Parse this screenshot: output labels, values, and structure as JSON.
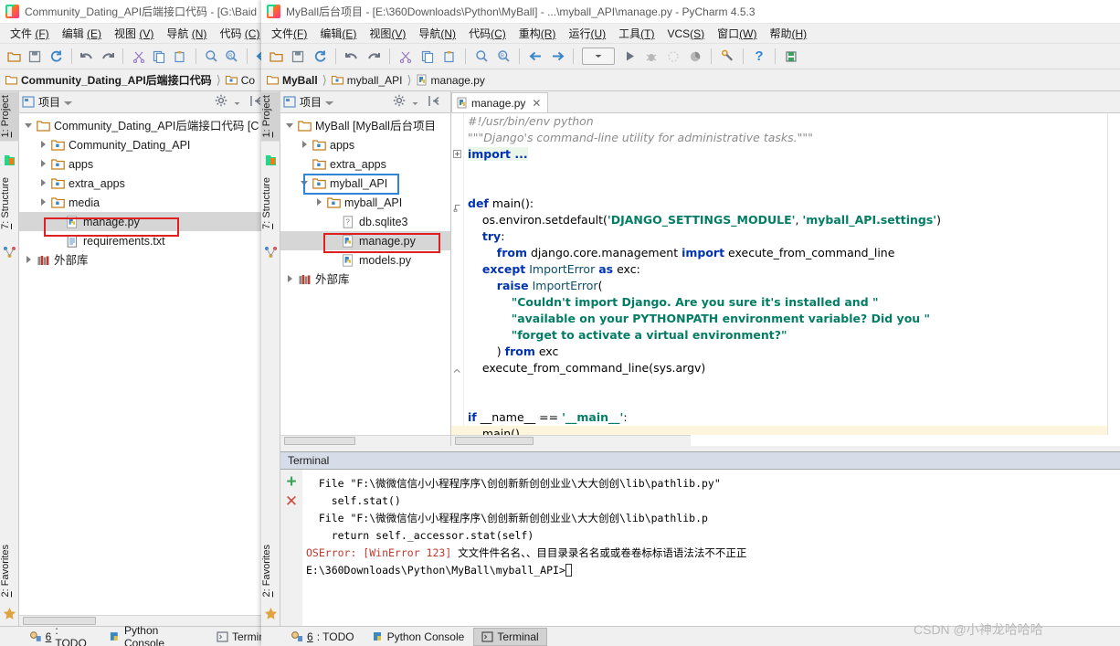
{
  "left_window": {
    "title": "Community_Dating_API后端接口代码 - [G:\\Baid",
    "menus": [
      {
        "label": "文件",
        "mnemonic": "(F)"
      },
      {
        "label": "编辑",
        "mnemonic": "(E)"
      },
      {
        "label": "视图",
        "mnemonic": "(V)"
      },
      {
        "label": "导航",
        "mnemonic": "(N)"
      },
      {
        "label": "代码",
        "mnemonic": "(C)"
      }
    ],
    "breadcrumbs": [
      {
        "label": "Community_Dating_API后端接口代码",
        "icon": "folder-icon",
        "bold": true
      },
      {
        "label": "Co",
        "icon": "module-folder-icon",
        "bold": false
      }
    ],
    "rail_tabs": [
      {
        "num": "1",
        "label": ": Project",
        "icon": "project-icon",
        "active": true
      },
      {
        "num": "7",
        "label": ": Structure",
        "icon": "structure-icon",
        "active": false
      },
      {
        "num": "2",
        "label": ": Favorites",
        "icon": "star-icon",
        "active": false
      }
    ],
    "tool_window": {
      "title": "项目",
      "gear_icon": "gear-icon",
      "collapse_icon": "collapse-all-icon"
    },
    "tree": [
      {
        "label": "Community_Dating_API后端接口代码 [C",
        "icon": "folder-icon",
        "twisty": "expanded",
        "indent": 0,
        "bold_part": "[C",
        "selected": false
      },
      {
        "label": "Community_Dating_API",
        "icon": "module-folder-icon",
        "twisty": "collapsed",
        "indent": 1,
        "selected": false
      },
      {
        "label": "apps",
        "icon": "module-folder-icon",
        "twisty": "collapsed",
        "indent": 1,
        "selected": false
      },
      {
        "label": "extra_apps",
        "icon": "module-folder-icon",
        "twisty": "collapsed",
        "indent": 1,
        "selected": false
      },
      {
        "label": "media",
        "icon": "module-folder-icon",
        "twisty": "collapsed",
        "indent": 1,
        "selected": false
      },
      {
        "label": "manage.py",
        "icon": "python-file-icon",
        "twisty": "none",
        "indent": 2,
        "selected": true,
        "highlight": "red"
      },
      {
        "label": "requirements.txt",
        "icon": "text-file-icon",
        "twisty": "none",
        "indent": 2,
        "selected": false
      },
      {
        "label": "外部库",
        "icon": "external-library-icon",
        "twisty": "collapsed",
        "indent": 0,
        "selected": false
      }
    ],
    "statusbar": [
      {
        "num": "6",
        "label": ": TODO",
        "icon": "todo-icon",
        "active": false
      },
      {
        "num": "",
        "label": "Python Console",
        "icon": "python-console-icon",
        "active": false
      },
      {
        "num": "",
        "label": "Termin",
        "icon": "terminal-icon",
        "active": false
      }
    ]
  },
  "right_window": {
    "title": "MyBall后台项目 - [E:\\360Downloads\\Python\\MyBall] - ...\\myball_API\\manage.py - PyCharm 4.5.3",
    "menus": [
      {
        "label": "文件",
        "mnemonic": "(F)"
      },
      {
        "label": "编辑",
        "mnemonic": "(E)"
      },
      {
        "label": "视图",
        "mnemonic": "(V)"
      },
      {
        "label": "导航",
        "mnemonic": "(N)"
      },
      {
        "label": "代码",
        "mnemonic": "(C)"
      },
      {
        "label": "重构",
        "mnemonic": "(R)"
      },
      {
        "label": "运行",
        "mnemonic": "(U)"
      },
      {
        "label": "工具",
        "mnemonic": "(T)"
      },
      {
        "label": "VCS",
        "mnemonic": "(S)"
      },
      {
        "label": "窗口",
        "mnemonic": "(W)"
      },
      {
        "label": "帮助",
        "mnemonic": "(H)"
      }
    ],
    "breadcrumbs": [
      {
        "label": "MyBall",
        "icon": "folder-icon",
        "bold": true
      },
      {
        "label": "myball_API",
        "icon": "module-folder-icon",
        "bold": false
      },
      {
        "label": "manage.py",
        "icon": "python-file-icon",
        "bold": false
      }
    ],
    "rail_tabs": [
      {
        "num": "1",
        "label": ": Project",
        "icon": "project-icon",
        "active": true
      },
      {
        "num": "7",
        "label": ": Structure",
        "icon": "structure-icon",
        "active": false
      },
      {
        "num": "2",
        "label": ": Favorites",
        "icon": "star-icon",
        "active": false
      }
    ],
    "tool_window": {
      "title": "项目",
      "gear_icon": "gear-icon",
      "collapse_icon": "collapse-all-icon"
    },
    "tree": [
      {
        "label": "MyBall [MyBall后台项目",
        "icon": "folder-icon",
        "twisty": "expanded",
        "indent": 0,
        "selected": false
      },
      {
        "label": "apps",
        "icon": "module-folder-icon",
        "twisty": "collapsed",
        "indent": 1,
        "selected": false
      },
      {
        "label": "extra_apps",
        "icon": "module-folder-icon",
        "twisty": "none",
        "indent": 1,
        "selected": false
      },
      {
        "label": "myball_API",
        "icon": "module-folder-icon",
        "twisty": "expanded",
        "indent": 1,
        "selected": false,
        "highlight": "blue"
      },
      {
        "label": "myball_API",
        "icon": "module-folder-icon",
        "twisty": "collapsed",
        "indent": 2,
        "selected": false
      },
      {
        "label": "db.sqlite3",
        "icon": "sqlite-file-icon",
        "twisty": "none",
        "indent": 3,
        "selected": false
      },
      {
        "label": "manage.py",
        "icon": "python-file-icon",
        "twisty": "none",
        "indent": 3,
        "selected": true,
        "highlight": "red"
      },
      {
        "label": "models.py",
        "icon": "python-file-icon",
        "twisty": "none",
        "indent": 3,
        "selected": false
      },
      {
        "label": "外部库",
        "icon": "external-library-icon",
        "twisty": "collapsed",
        "indent": 0,
        "selected": false
      }
    ],
    "editor": {
      "tab": {
        "label": "manage.py",
        "icon": "python-file-icon",
        "close_icon": "close-icon"
      },
      "lines": [
        {
          "indent": 0,
          "type": "comment",
          "text": "#!/usr/bin/env python"
        },
        {
          "indent": 0,
          "type": "comment",
          "text": "\"\"\"Django's command-line utility for administrative tasks.\"\"\""
        },
        {
          "indent": 0,
          "type": "import-fold",
          "text": "import ..."
        },
        {
          "indent": 0,
          "type": "blank",
          "text": ""
        },
        {
          "indent": 0,
          "type": "blank",
          "text": ""
        },
        {
          "indent": 0,
          "type": "def",
          "text": "def main():"
        },
        {
          "indent": 1,
          "type": "code",
          "text": "os.environ.setdefault('DJANGO_SETTINGS_MODULE', 'myball_API.settings')"
        },
        {
          "indent": 1,
          "type": "kw",
          "text": "try:"
        },
        {
          "indent": 2,
          "type": "code",
          "text": "from django.core.management import execute_from_command_line"
        },
        {
          "indent": 1,
          "type": "kw",
          "text": "except ImportError as exc:"
        },
        {
          "indent": 2,
          "type": "kw",
          "text": "raise ImportError("
        },
        {
          "indent": 3,
          "type": "str",
          "text": "\"Couldn't import Django. Are you sure it's installed and \""
        },
        {
          "indent": 3,
          "type": "str",
          "text": "\"available on your PYTHONPATH environment variable? Did you \""
        },
        {
          "indent": 3,
          "type": "str",
          "text": "\"forget to activate a virtual environment?\""
        },
        {
          "indent": 2,
          "type": "code",
          "text": ") from exc"
        },
        {
          "indent": 1,
          "type": "code",
          "text": "execute_from_command_line(sys.argv)"
        },
        {
          "indent": 0,
          "type": "blank",
          "text": ""
        },
        {
          "indent": 0,
          "type": "blank",
          "text": ""
        },
        {
          "indent": 0,
          "type": "code",
          "text": "if __name__ == '__main__':"
        },
        {
          "indent": 1,
          "type": "code",
          "highlighted": true,
          "text": "main()"
        }
      ]
    },
    "terminal": {
      "tab_label": "Terminal",
      "add_icon": "plus-icon",
      "close_icon": "close-x-icon",
      "output": [
        "  File \"F:\\微微信信小小程程序序\\创创新新创创业业\\大大创创\\lib\\pathlib.py\"",
        "    self.stat()",
        "  File \"F:\\微微信信小小程程序序\\创创新新创创业业\\大大创创\\lib\\pathlib.p",
        "    return self._accessor.stat(self)",
        "OSError: [WinError 123] 文文件件名名、、目目录录名名或或卷卷标标语语法法不不正正",
        "",
        "E:\\360Downloads\\Python\\MyBall\\myball_API>"
      ]
    },
    "statusbar": [
      {
        "num": "6",
        "label": ": TODO",
        "icon": "todo-icon",
        "active": false
      },
      {
        "num": "",
        "label": "Python Console",
        "icon": "python-console-icon",
        "active": false
      },
      {
        "num": "",
        "label": "Terminal",
        "icon": "terminal-icon",
        "active": true
      }
    ]
  },
  "watermark": "CSDN @小神龙哈哈哈",
  "colors": {
    "accent_red": "#e02020",
    "accent_blue": "#2f86d8",
    "keyword": "#0033b3",
    "string": "#047d65",
    "comment": "#8c8c8c",
    "panel": "#f0f0f0",
    "terminal_tab": "#d6dce8",
    "selection": "#d6d6d6"
  }
}
